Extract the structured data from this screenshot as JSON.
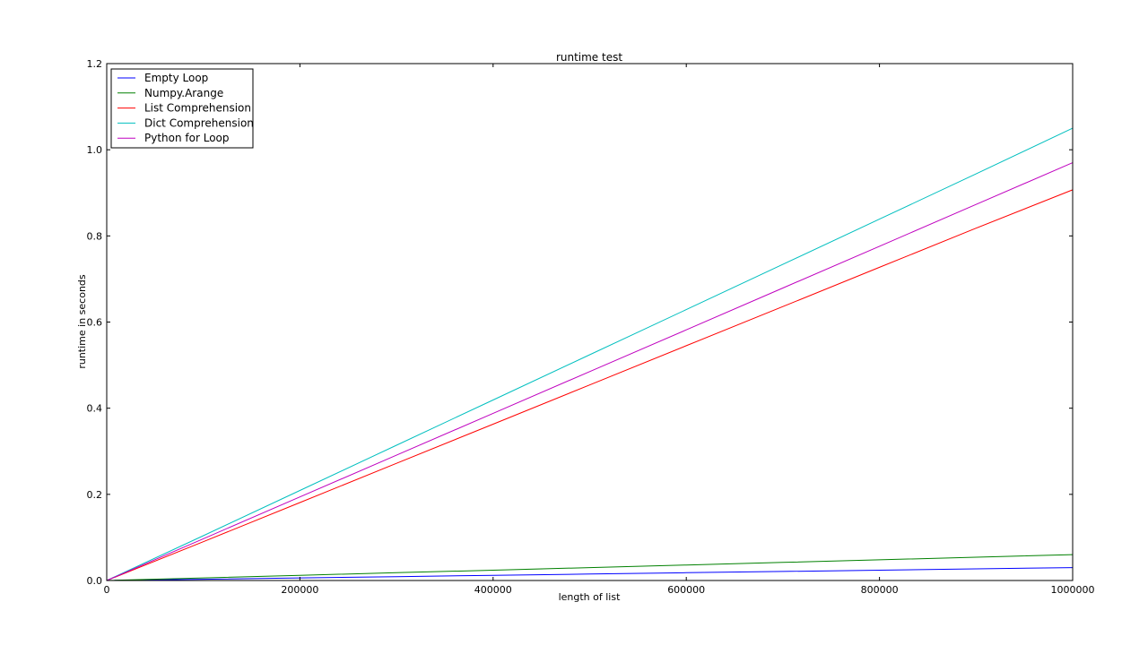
{
  "chart_data": {
    "type": "line",
    "title": "runtime test",
    "xlabel": "length of list",
    "ylabel": "runtime in seconds",
    "xlim": [
      0,
      1000000
    ],
    "ylim": [
      0,
      1.2
    ],
    "x_ticks": [
      0,
      200000,
      400000,
      600000,
      800000,
      1000000
    ],
    "x_tick_labels": [
      "0",
      "200000",
      "400000",
      "600000",
      "800000",
      "1000000"
    ],
    "y_ticks": [
      0.0,
      0.2,
      0.4,
      0.6,
      0.8,
      1.0,
      1.2
    ],
    "y_tick_labels": [
      "0.0",
      "0.2",
      "0.4",
      "0.6",
      "0.8",
      "1.0",
      "1.2"
    ],
    "grid": false,
    "legend_position": "top-left",
    "x": [
      0,
      100000,
      200000,
      300000,
      400000,
      500000,
      600000,
      700000,
      800000,
      900000,
      1000000
    ],
    "series": [
      {
        "name": "Empty Loop",
        "color": "#0000ff",
        "values": [
          0,
          0.003,
          0.006,
          0.009,
          0.012,
          0.015,
          0.018,
          0.021,
          0.024,
          0.027,
          0.03
        ]
      },
      {
        "name": "Numpy.Arange",
        "color": "#008000",
        "values": [
          0,
          0.006,
          0.012,
          0.018,
          0.024,
          0.03,
          0.036,
          0.042,
          0.048,
          0.054,
          0.06
        ]
      },
      {
        "name": "List Comprehension",
        "color": "#ff0000",
        "values": [
          0,
          0.09,
          0.181,
          0.272,
          0.363,
          0.454,
          0.545,
          0.636,
          0.727,
          0.818,
          0.907
        ]
      },
      {
        "name": "Dict Comprehension",
        "color": "#00bfbf",
        "values": [
          0,
          0.104,
          0.209,
          0.314,
          0.419,
          0.524,
          0.629,
          0.734,
          0.839,
          0.944,
          1.05
        ]
      },
      {
        "name": "Python for Loop",
        "color": "#bf00bf",
        "values": [
          0,
          0.097,
          0.194,
          0.291,
          0.388,
          0.485,
          0.582,
          0.679,
          0.776,
          0.873,
          0.97
        ]
      }
    ]
  }
}
